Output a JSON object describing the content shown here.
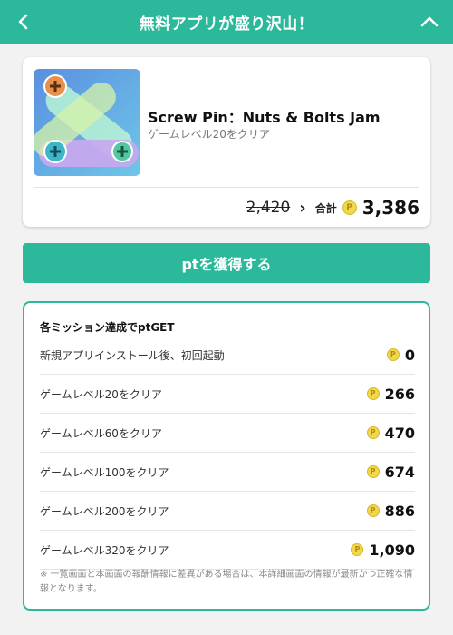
{
  "header": {
    "title": "無料アプリが盛り沢山！"
  },
  "app": {
    "name": "Screw Pin：Nuts & Bolts Jam",
    "mission": "ゲームレベル20をクリア",
    "old_price": "2,420",
    "total_label": "合計",
    "total_value": "3,386"
  },
  "cta": {
    "label": "ptを獲得する"
  },
  "missions": {
    "title": "各ミッション達成でptGET",
    "rows": [
      {
        "label": "新規アプリインストール後、初回起動",
        "points": "0"
      },
      {
        "label": "ゲームレベル20をクリア",
        "points": "266"
      },
      {
        "label": "ゲームレベル60をクリア",
        "points": "470"
      },
      {
        "label": "ゲームレベル100をクリア",
        "points": "674"
      },
      {
        "label": "ゲームレベル200をクリア",
        "points": "886"
      },
      {
        "label": "ゲームレベル320をクリア",
        "points": "1,090"
      }
    ],
    "note": "※ 一覧画面と本画面の報酬情報に差異がある場合は、本詳細画面の情報が最新かつ正確な情報となります。"
  },
  "icons": {
    "back": "chevron-left-icon",
    "collapse": "chevron-up-icon",
    "coin": "point-coin-icon"
  },
  "colors": {
    "accent": "#2bb89b",
    "coin": "#f2d64b"
  }
}
